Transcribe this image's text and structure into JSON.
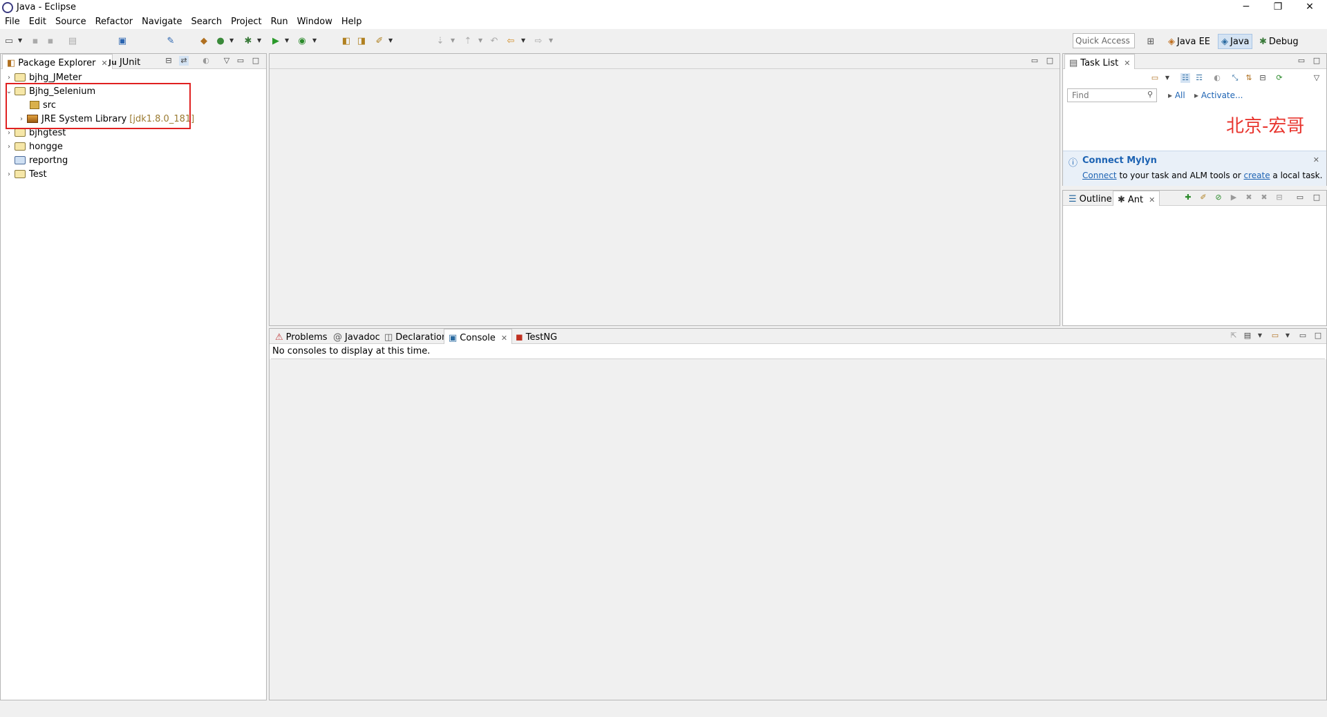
{
  "window": {
    "title": "Java - Eclipse",
    "minimize_glyph": "─",
    "restore_glyph": "❐",
    "close_glyph": "✕"
  },
  "menu": [
    "File",
    "Edit",
    "Source",
    "Refactor",
    "Navigate",
    "Search",
    "Project",
    "Run",
    "Window",
    "Help"
  ],
  "toolbar": {
    "quick_access_placeholder": "Quick Access",
    "perspectives": [
      {
        "label": "Java EE",
        "selected": false
      },
      {
        "label": "Java",
        "selected": true
      },
      {
        "label": "Debug",
        "selected": false
      }
    ]
  },
  "package_explorer": {
    "tabs": [
      "Package Explorer",
      "JUnit"
    ],
    "junit_prefix": "Ju",
    "tree": [
      {
        "label": "bjhg_JMeter",
        "expanded": false,
        "level": 0
      },
      {
        "label": "Bjhg_Selenium",
        "expanded": true,
        "level": 0
      },
      {
        "label": "src",
        "level": 1
      },
      {
        "label": "JRE System Library",
        "decoration": "[jdk1.8.0_181]",
        "level": 1
      },
      {
        "label": "bjhgtest",
        "expanded": false,
        "level": 0
      },
      {
        "label": "hongge",
        "expanded": false,
        "level": 0
      },
      {
        "label": "reportng",
        "level": 0
      },
      {
        "label": "Test",
        "expanded": false,
        "level": 0
      }
    ]
  },
  "task_list": {
    "tab": "Task List",
    "find_placeholder": "Find",
    "filter_all": "All",
    "filter_activate": "Activate...",
    "watermark": "北京-宏哥",
    "mylyn_title": "Connect Mylyn",
    "mylyn_link1": "Connect",
    "mylyn_text1": " to your task and ALM tools or ",
    "mylyn_link2": "create",
    "mylyn_text2": " a local task."
  },
  "outline": {
    "tabs": [
      "Outline",
      "Ant"
    ]
  },
  "console": {
    "tabs": [
      "Problems",
      "Javadoc",
      "Declaration",
      "Console",
      "TestNG"
    ],
    "active_tab": "Console",
    "message": "No consoles to display at this time."
  },
  "colors": {
    "accent_red": "#e02020",
    "link_blue": "#1d63b3",
    "watermark_red": "#e8352e"
  }
}
